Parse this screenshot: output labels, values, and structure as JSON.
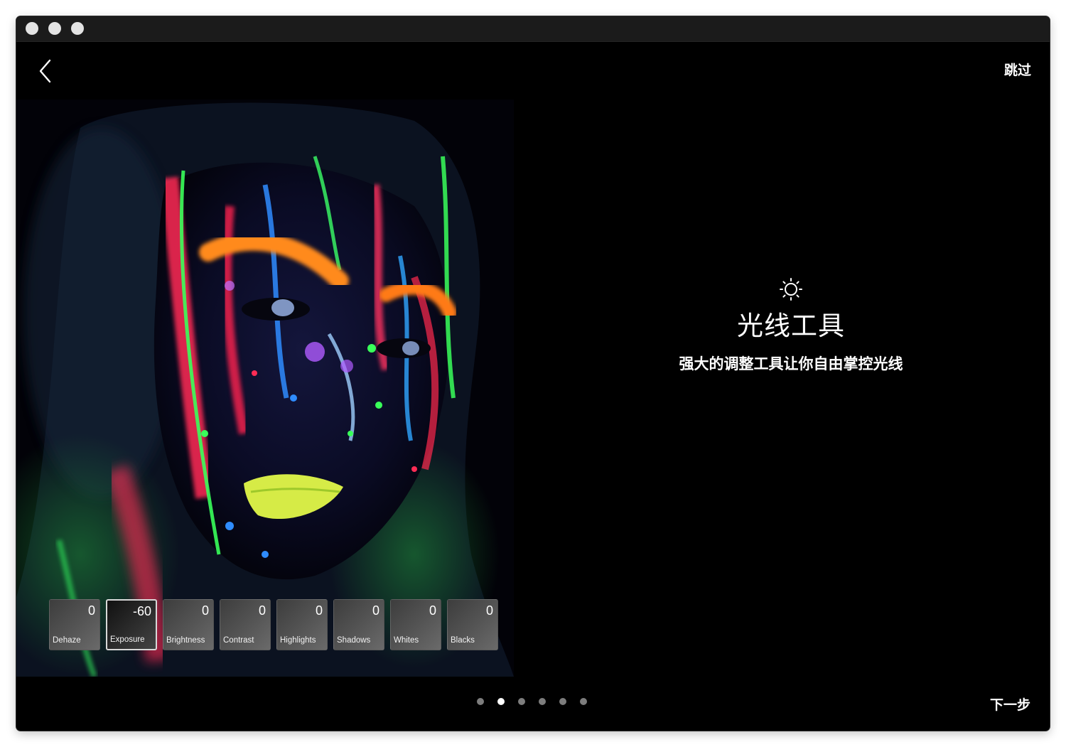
{
  "window": {
    "traffic_lights": [
      "close",
      "minimize",
      "zoom"
    ]
  },
  "nav": {
    "back_icon": "chevron-left-icon",
    "skip_label": "跳过",
    "next_label": "下一步"
  },
  "feature": {
    "icon": "sun-icon",
    "title": "光线工具",
    "subtitle": "强大的调整工具让你自由掌控光线"
  },
  "adjustments": [
    {
      "label": "Dehaze",
      "value": "0",
      "selected": false
    },
    {
      "label": "Exposure",
      "value": "-60",
      "selected": true
    },
    {
      "label": "Brightness",
      "value": "0",
      "selected": false
    },
    {
      "label": "Contrast",
      "value": "0",
      "selected": false
    },
    {
      "label": "Highlights",
      "value": "0",
      "selected": false
    },
    {
      "label": "Shadows",
      "value": "0",
      "selected": false
    },
    {
      "label": "Whites",
      "value": "0",
      "selected": false
    },
    {
      "label": "Blacks",
      "value": "0",
      "selected": false
    }
  ],
  "pager": {
    "total": 6,
    "active_index": 1
  },
  "colors": {
    "background": "#000000",
    "titlebar": "#1b1b1b",
    "text": "#ffffff",
    "dot_inactive": "#7d7d7d",
    "dot_active": "#ffffff"
  }
}
